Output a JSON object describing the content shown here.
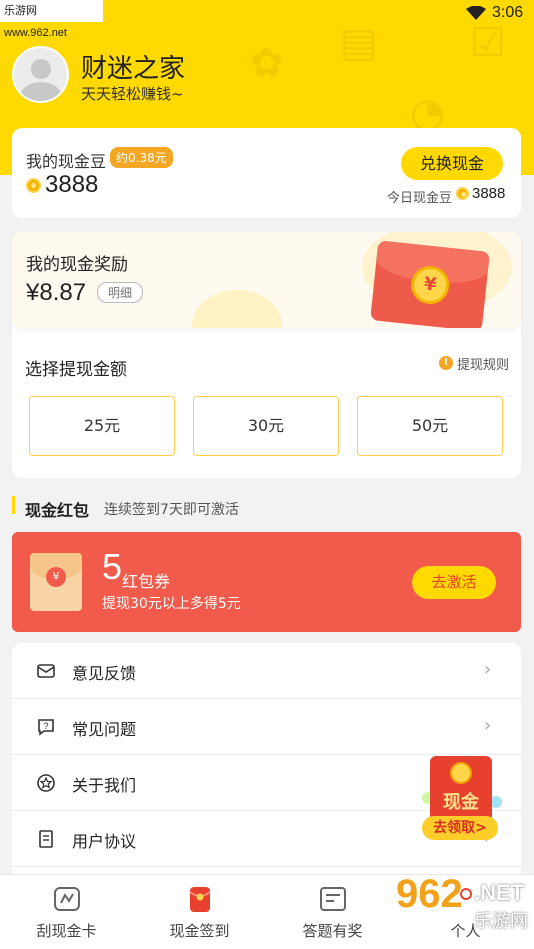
{
  "status": {
    "watermark": "乐游网 www.962.net",
    "time": "3:06"
  },
  "profile": {
    "name": "财迷之家",
    "slogan": "天天轻松赚钱~"
  },
  "beans": {
    "label": "我的现金豆",
    "approx": "约0.38元",
    "value": "3888",
    "exchange_label": "兑换现金",
    "today_label": "今日现金豆",
    "today_value": "3888"
  },
  "reward": {
    "label": "我的现金奖励",
    "value": "¥8.87",
    "detail_label": "明细",
    "envelope_symbol": "¥"
  },
  "withdraw": {
    "title": "选择提现金额",
    "rule_label": "提现规则",
    "options": [
      "25元",
      "30元",
      "50元"
    ]
  },
  "cash_redpacket": {
    "title": "现金红包",
    "subtitle": "连续签到7天即可激活",
    "count": "5",
    "unit": "红包券",
    "desc": "提现30元以上多得5元",
    "activate_label": "去激活",
    "envelope_symbol": "¥"
  },
  "menu": {
    "items": [
      {
        "label": "意见反馈",
        "icon": "feedback-icon"
      },
      {
        "label": "常见问题",
        "icon": "question-icon"
      },
      {
        "label": "关于我们",
        "icon": "star-badge-icon"
      },
      {
        "label": "用户协议",
        "icon": "document-icon"
      }
    ]
  },
  "float_promo": {
    "text": "现金",
    "button": "去领取>"
  },
  "tabbar": {
    "tabs": [
      {
        "label": "刮现金卡",
        "icon": "scratch-card-icon"
      },
      {
        "label": "现金签到",
        "icon": "redpacket-icon"
      },
      {
        "label": "答题有奖",
        "icon": "quiz-icon"
      },
      {
        "label": "个人",
        "icon": "profile-icon"
      }
    ]
  },
  "watermark": {
    "big": "962",
    "net": ".NET",
    "cn": "乐游网"
  },
  "colors": {
    "brand_yellow": "#ffd900",
    "coupon_red": "#f25b4c",
    "accent_orange": "#f5a623"
  }
}
